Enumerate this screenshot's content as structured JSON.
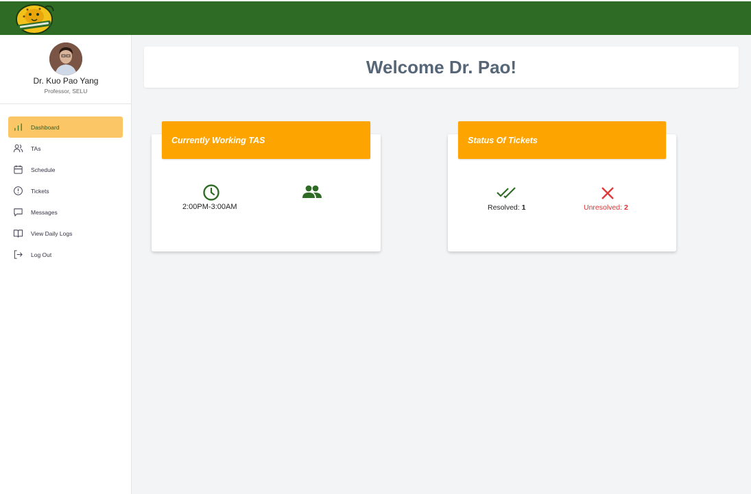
{
  "brand": {
    "logo_icon": "jaguar-mascot-logo",
    "header_color": "#2e6b25"
  },
  "profile": {
    "name": "Dr. Kuo Pao Yang",
    "role": "Professor, SELU",
    "avatar_icon": "user-avatar"
  },
  "sidebar": {
    "items": [
      {
        "label": "Dashboard",
        "icon": "bar-chart-icon",
        "active": true
      },
      {
        "label": "TAs",
        "icon": "users-icon"
      },
      {
        "label": "Schedule",
        "icon": "calendar-icon"
      },
      {
        "label": "Tickets",
        "icon": "alert-circle-icon"
      },
      {
        "label": "Messages",
        "icon": "message-icon"
      },
      {
        "label": "View Daily Logs",
        "icon": "book-icon"
      },
      {
        "label": "Log Out",
        "icon": "logout-icon"
      }
    ],
    "active_color": "#fbc666"
  },
  "main": {
    "welcome": "Welcome Dr. Pao!",
    "cards": [
      {
        "title": "Currently Working TAS",
        "time": "2:00PM-3:00AM",
        "icons": [
          "clock-icon",
          "people-icon"
        ]
      },
      {
        "title": "Status Of Tickets",
        "resolved_label": "Resolved:",
        "resolved_count": "1",
        "unresolved_label": "Unresolved:",
        "unresolved_count": "2",
        "icons": [
          "double-check-icon",
          "x-icon"
        ]
      }
    ],
    "header_color": "#fea400"
  }
}
